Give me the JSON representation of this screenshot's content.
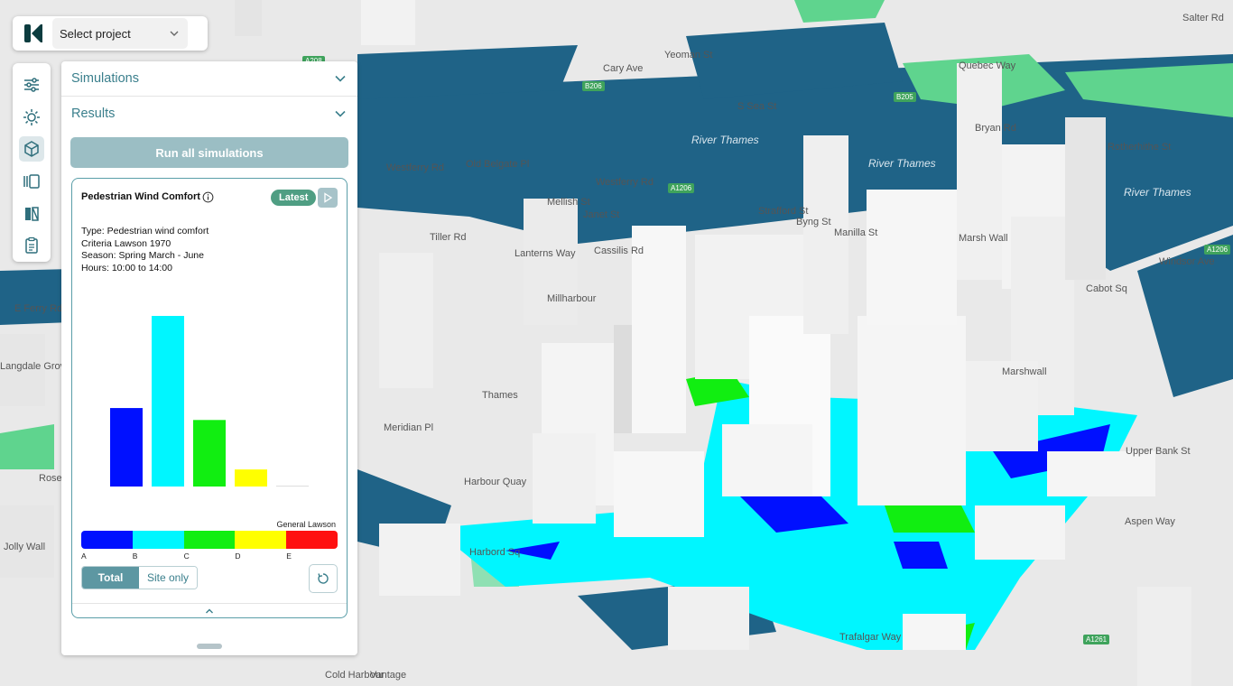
{
  "project_bar": {
    "select_label": "Select project"
  },
  "panel": {
    "simulations_label": "Simulations",
    "results_label": "Results",
    "run_button": "Run all simulations"
  },
  "card": {
    "title": "Pedestrian Wind Comfort",
    "badge": "Latest",
    "details": [
      "Type: Pedestrian wind comfort",
      "Criteria Lawson 1970",
      "Season: Spring  March - June",
      "Hours: 10:00 to 14:00"
    ],
    "scale_title": "General Lawson",
    "toggle_total": "Total",
    "toggle_site": "Site only"
  },
  "chart_data": {
    "type": "bar",
    "categories": [
      "A",
      "B",
      "C",
      "D",
      "E"
    ],
    "values": [
      0.46,
      1.0,
      0.39,
      0.1,
      0.005
    ],
    "colors": [
      "#0010ff",
      "#00f6ff",
      "#11ee11",
      "#ffff00",
      "#ff1010"
    ],
    "ylim": [
      0,
      1
    ]
  },
  "map_labels": {
    "water": [
      "River Thames",
      "River Thames",
      "River Thames"
    ],
    "streets": [
      "E Ferry Rd",
      "Westferry Rd",
      "Westferry Rd",
      "Harbord Sq",
      "Aspen Way",
      "Upper Bank St",
      "Cabot Sq",
      "Marsh Wall",
      "Bryan Rd",
      "Rotherhithe St",
      "Cary Ave",
      "Yeoman St",
      "S Sea St",
      "Manilla St",
      "Byng St",
      "Strafford St",
      "Millharbour",
      "Lanterns Way",
      "Cassilis Rd",
      "Mellish St",
      "Janet St",
      "Tiller Rd",
      "Harbour Quay",
      "Meridian Pl",
      "Quebec Way",
      "Salter Rd",
      "Old Belgate Pl",
      "Trafalgar Way",
      "Cold Harbour",
      "Vantage",
      "Rose",
      "Jolly Wall",
      "Windsor Ave",
      "Langdale Grove",
      "Marshwall",
      "Thames"
    ],
    "roads": [
      "A1206",
      "A1206",
      "A1261",
      "B206",
      "B205",
      "A208"
    ]
  },
  "colors": {
    "accent": "#3a7f8c",
    "water": "#1f6387",
    "park": "#5fd48e"
  },
  "icons": [
    "logo-icon",
    "chevron-down-icon",
    "sliders-icon",
    "sun-icon",
    "cube-icon",
    "panels-icon",
    "compare-icon",
    "clipboard-icon",
    "info-icon",
    "play-icon",
    "reset-icon",
    "chevron-up-icon"
  ]
}
